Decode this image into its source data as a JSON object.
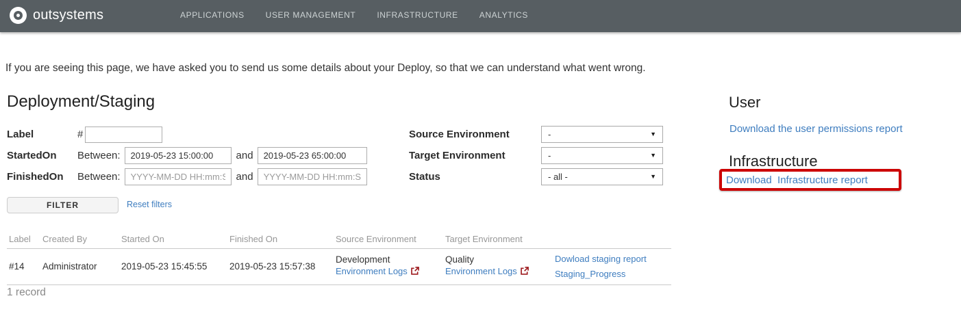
{
  "colors": {
    "header_bg": "#575E62",
    "nav_text": "#CDD3D4",
    "link": "#3E7DBF",
    "external_icon": "#9E1B1F",
    "highlight_box": "#CC0202",
    "text": "#333333",
    "muted": "#979797",
    "border": "#C9C9C9"
  },
  "header": {
    "logo_text": "outsystems",
    "nav": [
      "APPLICATIONS",
      "USER MANAGEMENT",
      "INFRASTRUCTURE",
      "ANALYTICS"
    ]
  },
  "intro": {
    "text": "If you are seeing this page, we have asked you to send us some details about your Deploy, so that we can understand what went wrong."
  },
  "deployment": {
    "title": "Deployment/Staging",
    "filters": {
      "label_row": {
        "label": "Label",
        "prefix": "#",
        "value": ""
      },
      "started_row": {
        "label": "StartedOn",
        "between": "Between:",
        "and": "and",
        "from": "2019-05-23 15:00:00",
        "to": "2019-05-23 65:00:00"
      },
      "finished_row": {
        "label": "FinishedOn",
        "between": "Between:",
        "and": "and",
        "placeholder": "YYYY-MM-DD HH:mm:SS"
      },
      "source_row": {
        "label": "Source Environment",
        "value": "-"
      },
      "target_row": {
        "label": "Target Environment",
        "value": "-"
      },
      "status_row": {
        "label": "Status",
        "value": "- all -"
      },
      "filter_button": "FILTER",
      "reset_link": "Reset filters"
    },
    "table": {
      "columns": [
        "Label",
        "Created By",
        "Started On",
        "Finished On",
        "Source Environment",
        "Target Environment"
      ],
      "row": {
        "label": "#14",
        "created_by": "Administrator",
        "started_on": "2019-05-23 15:45:55",
        "finished_on": "2019-05-23 15:57:38",
        "source_environment": {
          "name": "Development",
          "logs_label": "Environment Logs"
        },
        "target_environment": {
          "name": "Quality",
          "logs_label": "Environment Logs"
        },
        "actions": [
          {
            "label": "Dowload staging report"
          },
          {
            "label": "Staging_Progress"
          }
        ]
      },
      "record_count": "1 record"
    }
  },
  "side": {
    "user_title": "User",
    "user_link": "Download the user permissions report",
    "infra_title": "Infrastructure",
    "infra_link": "Download  Infrastructure report"
  }
}
